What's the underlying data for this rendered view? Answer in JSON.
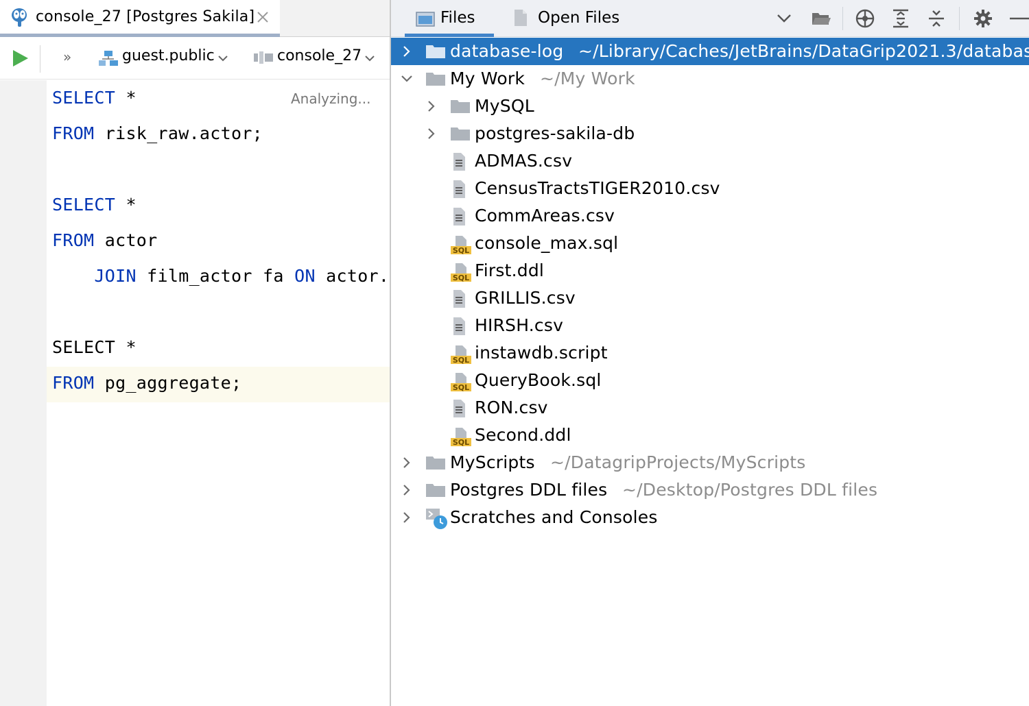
{
  "editor_tab": {
    "title": "console_27 [Postgres Sakila]",
    "icon": "postgres-elephant-icon"
  },
  "toolbar": {
    "schema": "guest.public",
    "console": "console_27",
    "more": "»"
  },
  "editor": {
    "status": "Analyzing...",
    "lines": [
      {
        "kw": "SELECT",
        "rest": " *"
      },
      {
        "kw": "FROM",
        "rest": " risk_raw.actor;"
      },
      {
        "kw": "SELECT",
        "rest": " *"
      },
      {
        "kw": "FROM",
        "rest": " actor"
      },
      {
        "indent": "    ",
        "kw": "JOIN",
        "mid": " film_actor fa ",
        "kw2": "ON",
        "rest": " actor."
      },
      {
        "plain": "SELECT *"
      },
      {
        "kw": "FROM",
        "rest": " pg_aggregate;"
      }
    ]
  },
  "project_panel": {
    "tabs": [
      {
        "label": "Files",
        "active": true
      },
      {
        "label": "Open Files",
        "active": false
      }
    ],
    "header_icons": [
      "chevron-down-icon",
      "open-folder-icon",
      "locate-icon",
      "expand-all-icon",
      "collapse-all-icon",
      "gear-icon",
      "minimize-icon"
    ],
    "tree": [
      {
        "label": "database-log",
        "path": "~/Library/Caches/JetBrains/DataGrip2021.3/databas",
        "type": "folder",
        "expand": "collapsed",
        "selected": true
      },
      {
        "label": "My Work",
        "path": "~/My Work",
        "type": "folder",
        "expand": "expanded"
      },
      {
        "label": "MySQL",
        "type": "folder",
        "expand": "collapsed"
      },
      {
        "label": "postgres-sakila-db",
        "type": "folder",
        "expand": "collapsed"
      },
      {
        "label": "ADMAS.csv",
        "type": "text"
      },
      {
        "label": "CensusTractsTIGER2010.csv",
        "type": "text"
      },
      {
        "label": "CommAreas.csv",
        "type": "text"
      },
      {
        "label": "console_max.sql",
        "type": "sql"
      },
      {
        "label": "First.ddl",
        "type": "sql"
      },
      {
        "label": "GRILLIS.csv",
        "type": "text"
      },
      {
        "label": "HIRSH.csv",
        "type": "text"
      },
      {
        "label": "instawdb.script",
        "type": "sql"
      },
      {
        "label": "QueryBook.sql",
        "type": "sql"
      },
      {
        "label": "RON.csv",
        "type": "text"
      },
      {
        "label": "Second.ddl",
        "type": "sql"
      },
      {
        "label": "MyScripts",
        "path": "~/DatagripProjects/MyScripts",
        "type": "folder",
        "expand": "collapsed"
      },
      {
        "label": "Postgres DDL files",
        "path": "~/Desktop/Postgres DDL files",
        "type": "folder",
        "expand": "collapsed"
      },
      {
        "label": "Scratches and Consoles",
        "type": "scratches",
        "expand": "collapsed"
      }
    ],
    "sql_badge": "SQL"
  },
  "colors": {
    "keyword": "#0033b3",
    "selection": "#2675bf",
    "run_green": "#4caf50",
    "path_gray": "#8c8c8c"
  }
}
